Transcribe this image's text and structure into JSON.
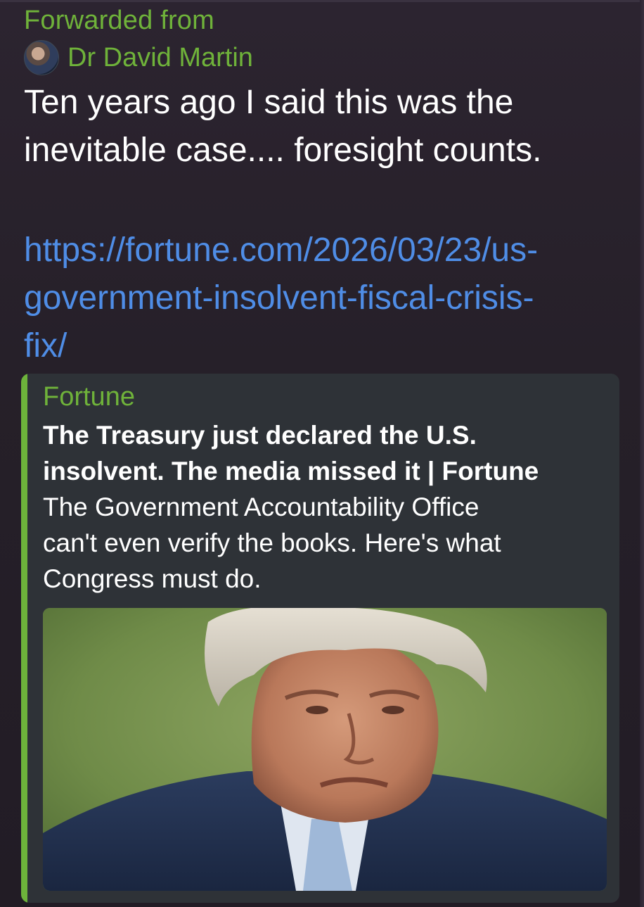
{
  "forward": {
    "label": "Forwarded from",
    "author": "Dr David Martin",
    "avatar_icon": "profile-photo-avatar"
  },
  "message": {
    "text_lines": [
      "Ten years ago I said this was the",
      "inevitable case.... foresight counts."
    ],
    "link_lines": [
      "https://fortune.com/2026/03/23/us-",
      "government-insolvent-fiscal-crisis-",
      "fix/"
    ]
  },
  "link_preview": {
    "site_name": "Fortune",
    "title_lines": [
      "The Treasury just declared the U.S.",
      "insolvent. The media missed it | Fortune"
    ],
    "description_lines": [
      "The Government Accountability Office",
      "can't even verify the books. Here's what",
      "Congress must do."
    ],
    "image": "photo of a grey-haired man in a navy suit and light blue tie, frowning, against a blurred green background"
  },
  "colors": {
    "background": "#231c26",
    "accent_green": "#6fb23a",
    "link_blue": "#4f8de6",
    "preview_bg": "#2e3237",
    "text": "#ffffff"
  }
}
